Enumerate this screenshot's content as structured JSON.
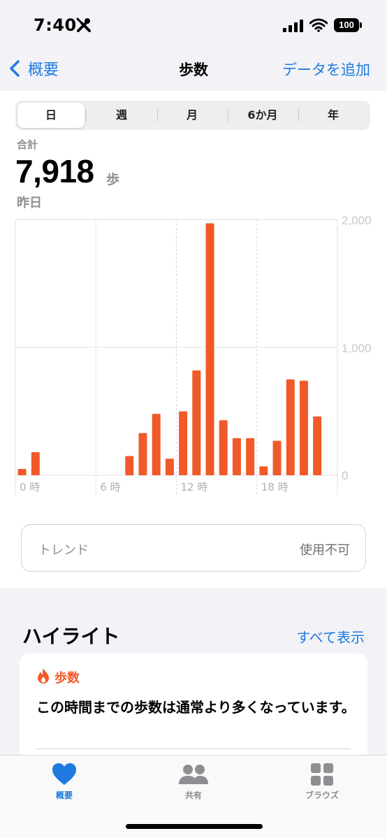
{
  "status_bar": {
    "time": "7:40",
    "battery": "100"
  },
  "nav": {
    "back_label": "概要",
    "title": "歩数",
    "add_label": "データを追加"
  },
  "segments": [
    "日",
    "週",
    "月",
    "6か月",
    "年"
  ],
  "summary": {
    "total_label": "合計",
    "total_value": "7,918",
    "unit": "歩",
    "date": "昨日"
  },
  "chart_data": {
    "type": "bar",
    "categories": [
      "0",
      "1",
      "2",
      "3",
      "4",
      "5",
      "6",
      "7",
      "8",
      "9",
      "10",
      "11",
      "12",
      "13",
      "14",
      "15",
      "16",
      "17",
      "18",
      "19",
      "20",
      "21",
      "22",
      "23"
    ],
    "values": [
      50,
      180,
      0,
      0,
      0,
      0,
      0,
      0,
      150,
      330,
      480,
      130,
      500,
      820,
      1970,
      430,
      290,
      290,
      70,
      270,
      750,
      740,
      460,
      0
    ],
    "xtick_labels": [
      "0 時",
      "6 時",
      "12 時",
      "18 時"
    ],
    "xtick_positions": [
      0,
      6,
      12,
      18
    ],
    "ytick_labels": [
      "2,000",
      "1,000",
      "0"
    ],
    "ytick_values": [
      2000,
      1000,
      0
    ],
    "ylim": [
      0,
      2000
    ],
    "bar_color": "#f05a28",
    "grid": true
  },
  "trend": {
    "label": "トレンド",
    "value": "使用不可"
  },
  "highlights": {
    "title": "ハイライト",
    "show_all": "すべて表示",
    "card": {
      "category": "歩数",
      "text": "この時間までの歩数は通常より多くなっています。"
    }
  },
  "tabs": [
    {
      "label": "概要",
      "icon": "heart-icon"
    },
    {
      "label": "共有",
      "icon": "people-icon"
    },
    {
      "label": "ブラウズ",
      "icon": "grid-icon"
    }
  ],
  "colors": {
    "accent": "#1f7ae0",
    "steps": "#f05a28"
  }
}
